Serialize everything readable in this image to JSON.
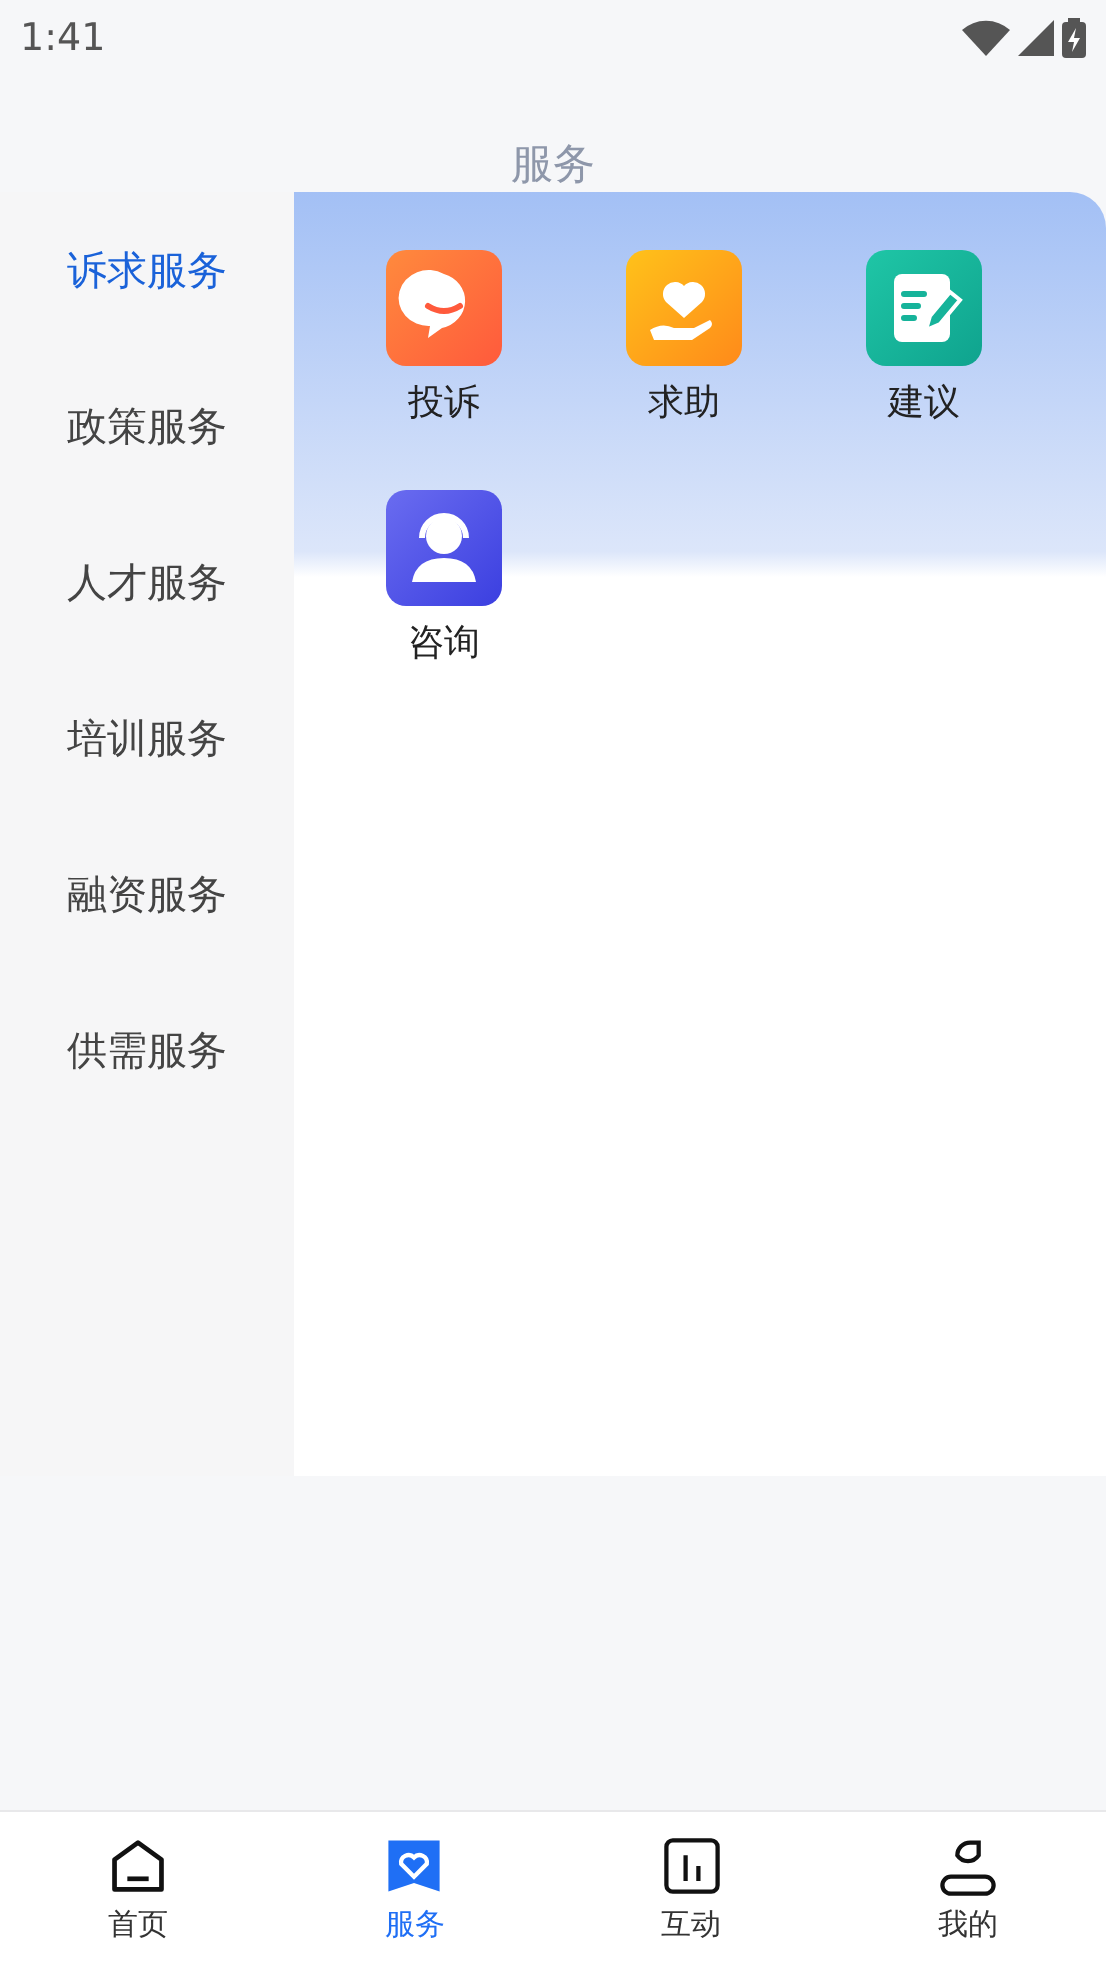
{
  "status_bar": {
    "time": "1:41"
  },
  "header": {
    "title": "服务"
  },
  "sidebar": {
    "items": [
      {
        "label": "诉求服务",
        "selected": true
      },
      {
        "label": "政策服务",
        "selected": false
      },
      {
        "label": "人才服务",
        "selected": false
      },
      {
        "label": "培训服务",
        "selected": false
      },
      {
        "label": "融资服务",
        "selected": false
      },
      {
        "label": "供需服务",
        "selected": false
      }
    ]
  },
  "services": [
    {
      "label": "投诉",
      "kind": "complaint"
    },
    {
      "label": "求助",
      "kind": "help"
    },
    {
      "label": "建议",
      "kind": "suggestion"
    },
    {
      "label": "咨询",
      "kind": "consult"
    }
  ],
  "tab_bar": [
    {
      "label": "首页",
      "kind": "home",
      "selected": false
    },
    {
      "label": "服务",
      "kind": "service",
      "selected": true
    },
    {
      "label": "互动",
      "kind": "interact",
      "selected": false
    },
    {
      "label": "我的",
      "kind": "profile",
      "selected": false
    }
  ]
}
